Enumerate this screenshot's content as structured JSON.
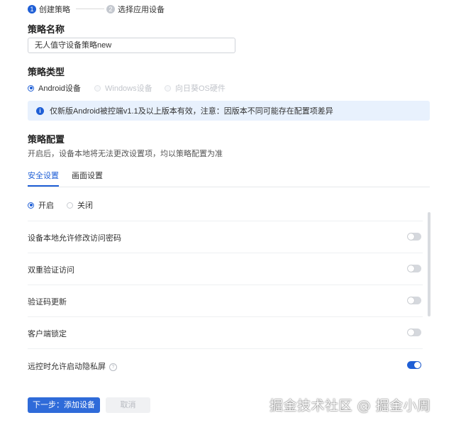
{
  "steps": [
    {
      "num": "1",
      "label": "创建策略"
    },
    {
      "num": "2",
      "label": "选择应用设备"
    }
  ],
  "policy_name": {
    "label": "策略名称",
    "value": "无人值守设备策略new"
  },
  "policy_type": {
    "label": "策略类型",
    "options": [
      {
        "label": "Android设备",
        "checked": true,
        "disabled": false
      },
      {
        "label": "Windows设备",
        "checked": false,
        "disabled": true
      },
      {
        "label": "向日葵OS硬件",
        "checked": false,
        "disabled": true
      }
    ]
  },
  "notice": {
    "icon": "info-icon",
    "text": "仅新版Android被控端v1.1及以上版本有效，注意：因版本不同可能存在配置项差异"
  },
  "policy_config": {
    "label": "策略配置",
    "desc": "开启后，设备本地将无法更改设置项，均以策略配置为准"
  },
  "tabs": [
    {
      "label": "安全设置",
      "active": true
    },
    {
      "label": "画面设置",
      "active": false
    }
  ],
  "switch_radio": [
    {
      "label": "开启",
      "checked": true
    },
    {
      "label": "关闭",
      "checked": false
    }
  ],
  "settings": [
    {
      "label": "设备本地允许修改访问密码",
      "on": false,
      "help": false
    },
    {
      "label": "双重验证访问",
      "on": false,
      "help": false
    },
    {
      "label": "验证码更新",
      "on": false,
      "help": false
    },
    {
      "label": "客户端锁定",
      "on": false,
      "help": false
    },
    {
      "label": "远控时允许启动隐私屏",
      "on": true,
      "help": true
    }
  ],
  "buttons": {
    "next": "下一步：添加设备",
    "cancel": "取消"
  },
  "watermark": "掘金技术社区 @ 掘金小周",
  "colors": {
    "accent": "#1f5fd6",
    "notice_bg": "#e8f1fd"
  }
}
